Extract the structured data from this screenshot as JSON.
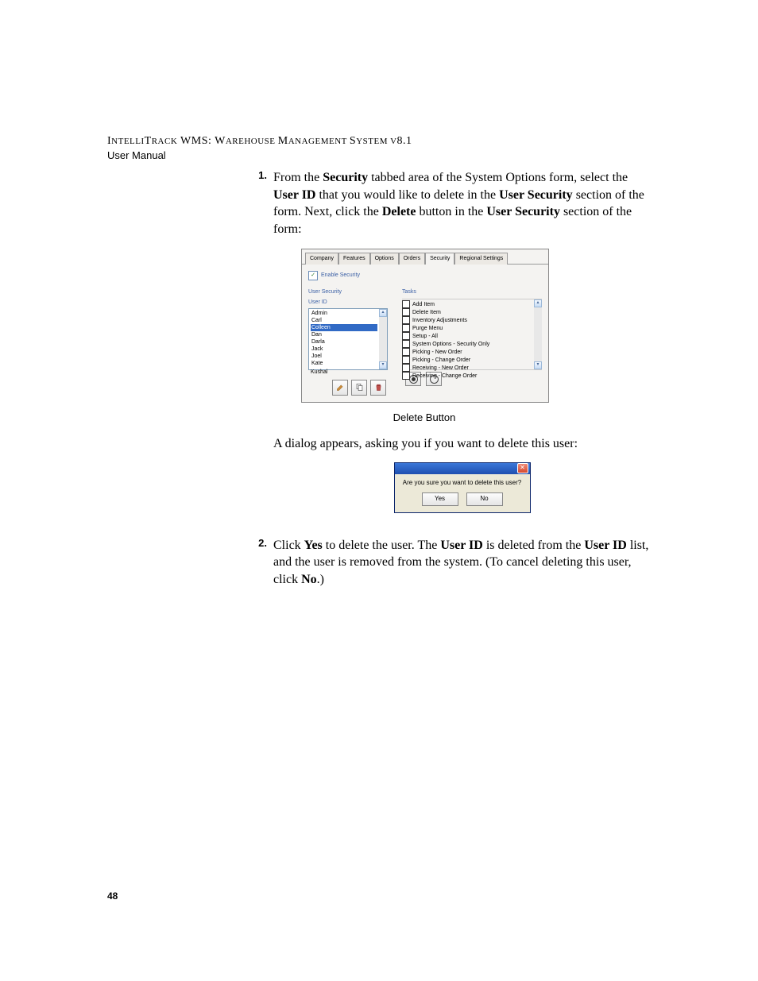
{
  "header": {
    "title_prefix": "I",
    "title_rest_1": "NTELLI",
    "title_mid": "T",
    "title_rest_2": "RACK",
    "title_wms": " WMS: W",
    "title_rest_3": "AREHOUSE ",
    "title_m": "M",
    "title_rest_4": "ANAGEMENT ",
    "title_s": "S",
    "title_rest_5": "YSTEM ",
    "title_ver": "V",
    "title_vernum": "8.1",
    "subtitle": "User Manual"
  },
  "steps": {
    "one_num": "1.",
    "one_pre": "From the ",
    "one_b1": "Security",
    "one_mid1": " tabbed area of the System Options form, select the ",
    "one_b2": "User ID",
    "one_mid2": " that you would like to delete in the ",
    "one_b3": "User Security",
    "one_mid3": " section of the form. Next, click the ",
    "one_b4": "Delete",
    "one_mid4": " button in the ",
    "one_b5": "User Security",
    "one_end": " section of the form:",
    "between": "A dialog appears, asking you if you want to delete this user:",
    "two_num": "2.",
    "two_pre": "Click ",
    "two_b1": "Yes",
    "two_mid1": " to delete the user. The ",
    "two_b2": "User ID",
    "two_mid2": " is deleted from the ",
    "two_b3": "User ID",
    "two_mid3": " list, and the user is removed from the system. (To cancel deleting this user, click ",
    "two_b4": "No",
    "two_end": ".)"
  },
  "shot1": {
    "tabs": [
      "Company",
      "Features",
      "Options",
      "Orders",
      "Security",
      "Regional Settings"
    ],
    "enable_label": "Enable Security",
    "user_security": "User Security",
    "user_id": "User ID",
    "users": [
      "Admin",
      "Carl",
      "Colleen",
      "Dan",
      "Darla",
      "Jack",
      "Joel",
      "Kate",
      "Kushal"
    ],
    "selected_user_index": 2,
    "tasks_title": "Tasks",
    "tasks": [
      "Add Item",
      "Delete Item",
      "Inventory Adjustments",
      "Purge Menu",
      "Setup - All",
      "System Options - Security Only",
      "Picking - New Order",
      "Picking - Change Order",
      "Receiving - New Order",
      "Receiving - Change Order"
    ],
    "caption": "Delete Button"
  },
  "dialog": {
    "msg": "Are you sure you want to delete this user?",
    "yes": "Yes",
    "no": "No"
  },
  "page_number": "48"
}
